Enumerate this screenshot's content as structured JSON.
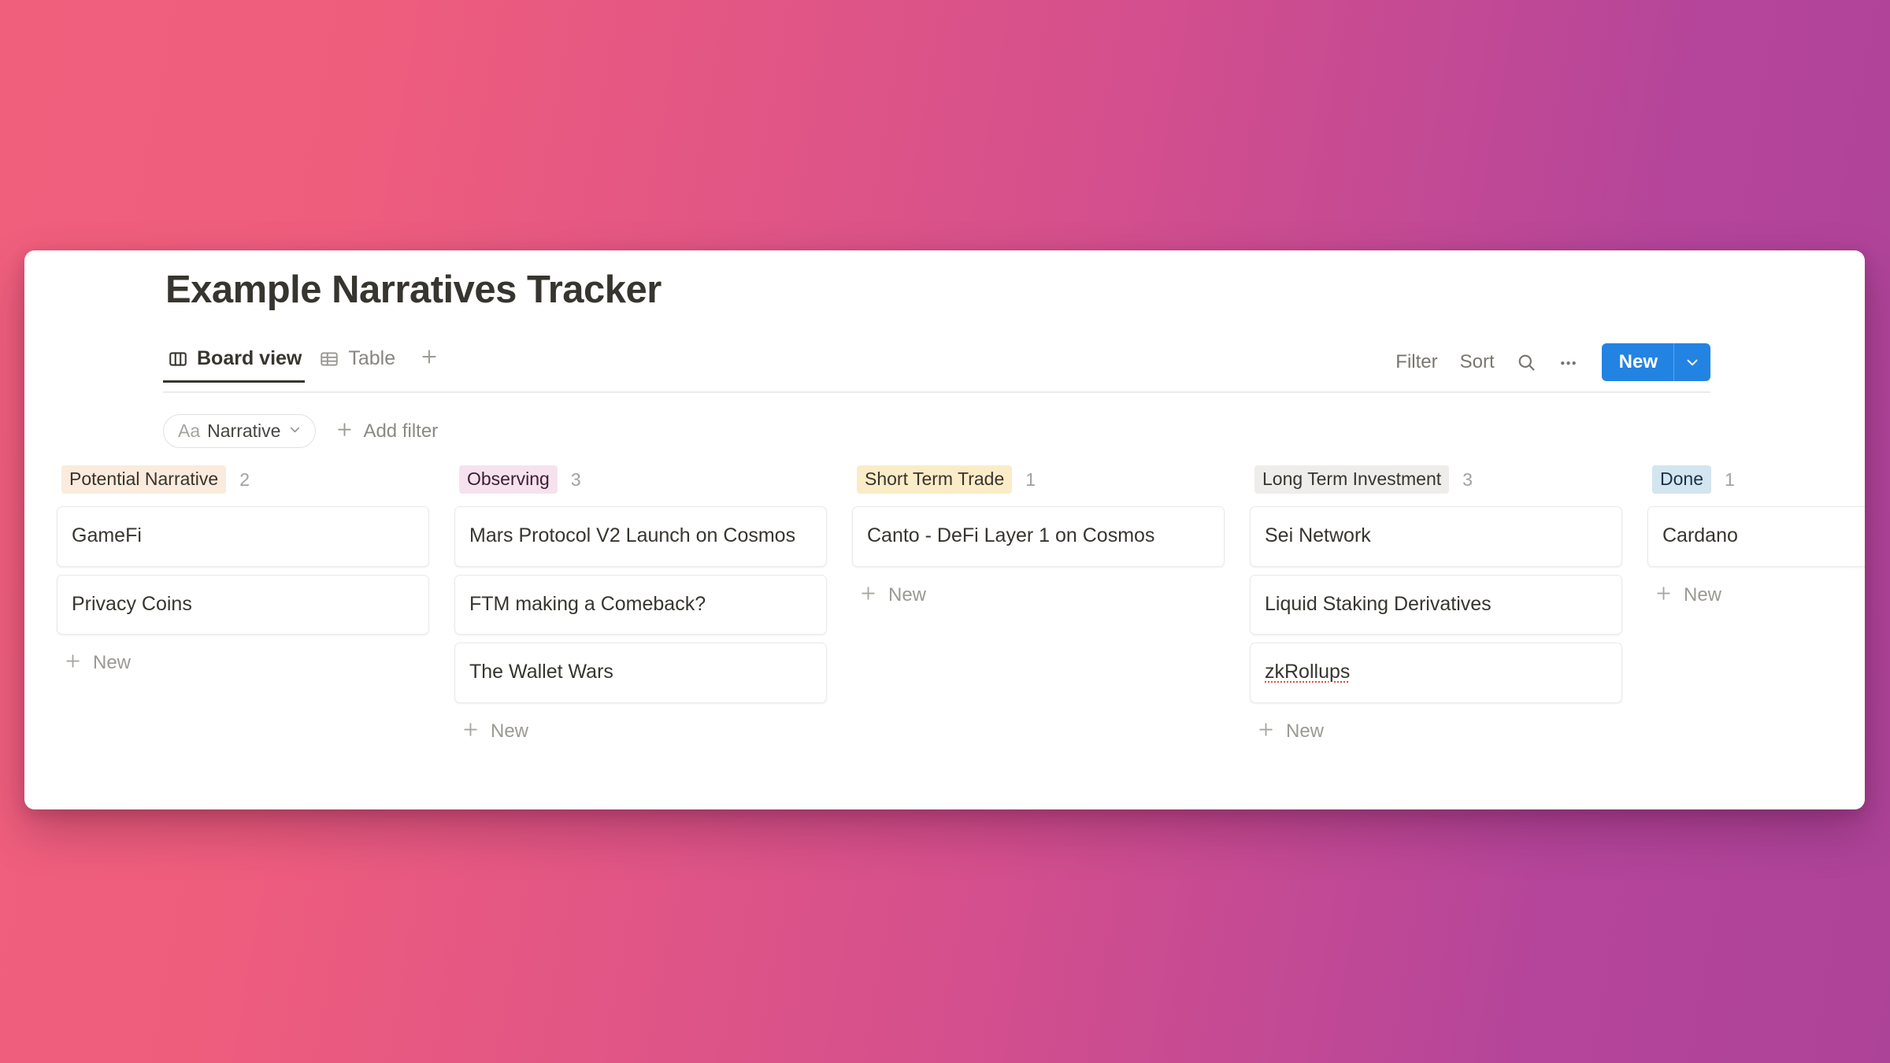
{
  "header": {
    "title": "Example Narratives Tracker"
  },
  "tabs": [
    {
      "label": "Board view",
      "icon": "board-columns-icon",
      "active": true
    },
    {
      "label": "Table",
      "icon": "table-grid-icon",
      "active": false
    }
  ],
  "tab_add": {
    "icon": "plus-icon"
  },
  "toolbar": {
    "filter_label": "Filter",
    "sort_label": "Sort",
    "search_icon": "search-icon",
    "more_icon": "ellipsis-icon",
    "new_label": "New",
    "new_caret_icon": "chevron-down-icon",
    "accent_color": "#2383e2"
  },
  "filters": {
    "active": {
      "prefix": "Aa",
      "name": "Narrative",
      "caret_icon": "chevron-down-icon"
    },
    "add_label": "Add filter",
    "add_icon": "plus-icon"
  },
  "board": {
    "new_label": "New",
    "new_icon": "plus-icon",
    "columns": [
      {
        "name": "Potential Narrative",
        "count": "2",
        "tag_bg": "#faebdd",
        "tag_fg": "#37352f",
        "cards": [
          {
            "title": "GameFi",
            "misspelled": false
          },
          {
            "title": "Privacy Coins",
            "misspelled": false
          }
        ]
      },
      {
        "name": "Observing",
        "count": "3",
        "tag_bg": "#f6e2ef",
        "tag_fg": "#3b1f33",
        "cards": [
          {
            "title": "Mars Protocol V2 Launch on Cosmos",
            "misspelled": false
          },
          {
            "title": "FTM making a Comeback?",
            "misspelled": false
          },
          {
            "title": "The Wallet Wars",
            "misspelled": false
          }
        ]
      },
      {
        "name": "Short Term Trade",
        "count": "1",
        "tag_bg": "#fbecc8",
        "tag_fg": "#37352f",
        "cards": [
          {
            "title": "Canto - DeFi Layer 1 on Cosmos",
            "misspelled": false
          }
        ]
      },
      {
        "name": "Long Term Investment",
        "count": "3",
        "tag_bg": "#eeedeb",
        "tag_fg": "#37352f",
        "cards": [
          {
            "title": "Sei Network",
            "misspelled": false
          },
          {
            "title": "Liquid Staking Derivatives",
            "misspelled": false
          },
          {
            "title": "zkRollups",
            "misspelled": true
          }
        ]
      },
      {
        "name": "Done",
        "count": "1",
        "tag_bg": "#d3e5ef",
        "tag_fg": "#183347",
        "cards": [
          {
            "title": "Cardano",
            "misspelled": false
          }
        ]
      }
    ]
  }
}
